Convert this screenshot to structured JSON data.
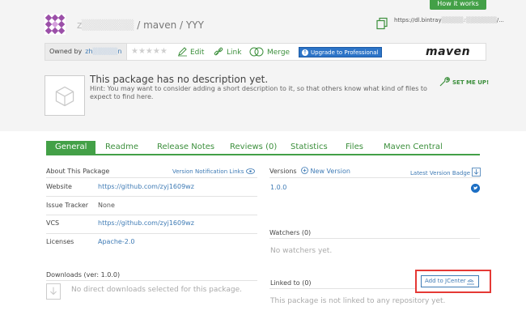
{
  "header": {
    "how_it_works": "How it works",
    "owner_blurred": "z",
    "path": "/ maven / YYY",
    "url": "https://dl.bintray",
    "url_tail": "/..."
  },
  "toolbar": {
    "owned_by": "Owned by",
    "owner_name": "zh",
    "owner_tail": "n",
    "stars": "★★★★★",
    "edit": "Edit",
    "link": "Link",
    "merge": "Merge",
    "upgrade": "Upgrade to Professional",
    "maven": "maven"
  },
  "description": {
    "title": "This package has no description yet.",
    "hint": "Hint: You may want to consider adding a short description to it, so that others know what kind of files to expect to find here.",
    "set_me_up": "SET ME UP!"
  },
  "tabs": [
    {
      "label": "General",
      "active": true
    },
    {
      "label": "Readme"
    },
    {
      "label": "Release Notes"
    },
    {
      "label": "Reviews (0)"
    },
    {
      "label": "Statistics"
    },
    {
      "label": "Files"
    },
    {
      "label": "Maven Central"
    }
  ],
  "about": {
    "title": "About This Package",
    "notification_link": "Version Notification Links",
    "rows": [
      {
        "label": "Website",
        "value": "https://github.com/zyj1609wz",
        "link": true
      },
      {
        "label": "Issue Tracker",
        "value": "None",
        "link": false
      },
      {
        "label": "VCS",
        "value": "https://github.com/zyj1609wz",
        "link": true
      },
      {
        "label": "Licenses",
        "value": "Apache-2.0",
        "link": true
      }
    ]
  },
  "versions": {
    "title": "Versions",
    "new_version": "New Version",
    "latest_badge": "Latest Version Badge",
    "items": [
      "1.0.0"
    ]
  },
  "watchers": {
    "title": "Watchers",
    "count": "(0)",
    "empty": "No watchers yet."
  },
  "downloads": {
    "title": "Downloads",
    "ver": "(ver: 1.0.0)",
    "empty": "No direct downloads selected for this package."
  },
  "linked": {
    "title": "Linked to (0)",
    "add_jcenter": "Add to JCenter",
    "empty": "This package is not linked to any repository yet."
  },
  "colors": {
    "green": "#43a047",
    "link_blue": "#3f7bb5",
    "highlight_red": "#e53935"
  }
}
